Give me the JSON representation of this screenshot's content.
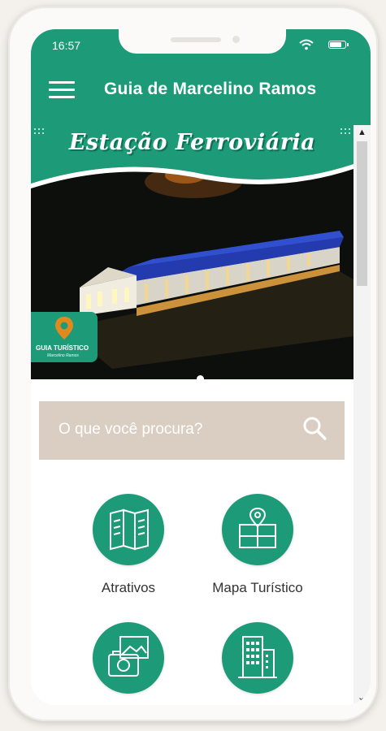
{
  "status_bar": {
    "time": "16:57"
  },
  "app_bar": {
    "title": "Guia de Marcelino Ramos"
  },
  "banner": {
    "title": "Estação Ferroviária",
    "logo_text": "GUIA TURÍSTICO",
    "logo_subtext": "Marcelino Ramos",
    "active_slide": 1
  },
  "search": {
    "placeholder": "O que você procura?"
  },
  "tiles": [
    {
      "label": "Atrativos",
      "icon": "brochure-icon"
    },
    {
      "label": "Mapa Turístico",
      "icon": "map-icon"
    },
    {
      "label": "",
      "icon": "photos-icon"
    },
    {
      "label": "",
      "icon": "buildings-icon"
    }
  ],
  "colors": {
    "primary": "#1d9a78",
    "search_bg": "#dacec2",
    "banner_bg": "#111311"
  }
}
